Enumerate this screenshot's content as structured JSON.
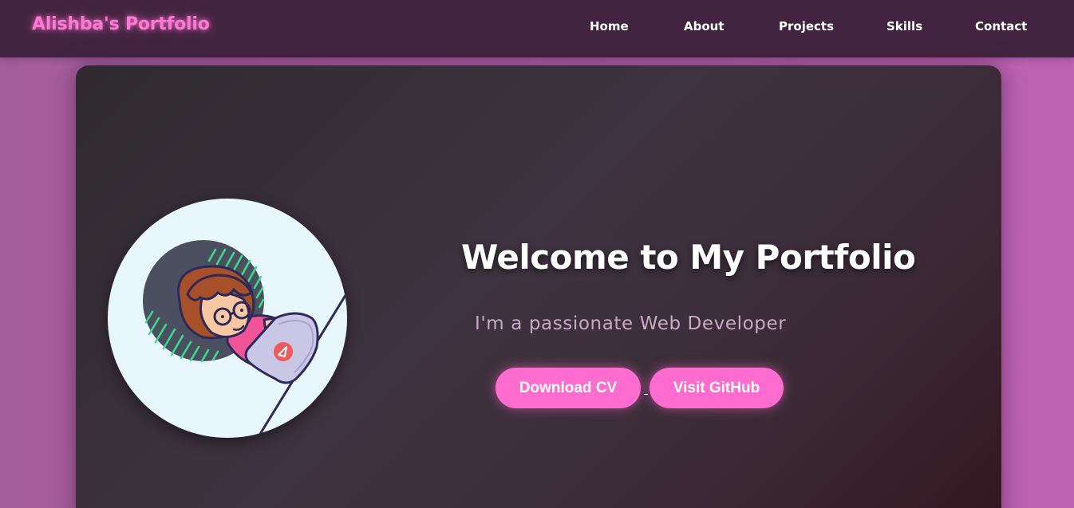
{
  "navbar": {
    "brand": "Alishba's Portfolio",
    "links": [
      {
        "label": "Home"
      },
      {
        "label": "About"
      },
      {
        "label": "Projects"
      },
      {
        "label": "Skills"
      },
      {
        "label": "Contact"
      }
    ]
  },
  "hero": {
    "title": "Welcome to My Portfolio",
    "subtitle": "I'm a passionate Web Developer",
    "buttons": {
      "download_cv": "Download CV",
      "visit_github": "Visit GitHub"
    },
    "avatar_icon": "girl-with-laptop-illustration"
  },
  "colors": {
    "accent": "#ff6ccf",
    "brand_glow": "#ff78d4",
    "navbar_bg": "#432440",
    "page_bg": "#b160a8",
    "card_bg": "#3e3340",
    "subtitle": "#c9a9c8"
  }
}
